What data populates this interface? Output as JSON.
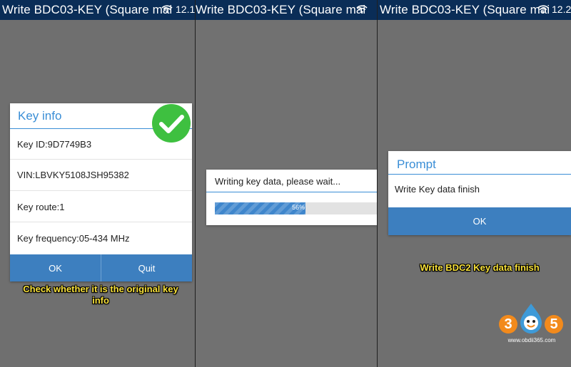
{
  "windows": {
    "left": {
      "title": "Write BDC03-KEY (Square mai",
      "clock": "12.1"
    },
    "middle": {
      "title": "Write BDC03-KEY (Square mai"
    },
    "right": {
      "title": "Write BDC03-KEY (Square mai",
      "clock": "12.2"
    }
  },
  "key_info_dialog": {
    "title": "Key info",
    "key_id": "Key ID:9D7749B3",
    "vin": "VIN:LBVKY5108JSH95382",
    "key_route": "Key route:1",
    "key_frequency": "Key frequency:05-434 MHz",
    "ok_label": "OK",
    "quit_label": "Quit"
  },
  "writing_dialog": {
    "message": "Writing key data, please wait...",
    "progress_text": "56%",
    "progress_percent": 56
  },
  "prompt_dialog": {
    "title": "Prompt",
    "message": "Write Key data finish",
    "ok_label": "OK"
  },
  "captions": {
    "left": "Check whether it is the original key info",
    "right": "Write BDC2 Key data finish"
  },
  "watermark": {
    "digits": "3 5",
    "site": "www.obdii365.com"
  },
  "colors": {
    "title_bar": "#0a2d57",
    "dialog_accent": "#3a8ed6",
    "button_bar": "#3d7fbf",
    "success_check": "#3ec040",
    "caption_text": "#f7e03a",
    "watermark_orange": "#f28a1c"
  },
  "icons": {
    "status": "wifi-icon",
    "check": "check-circle-icon",
    "logo": "obdii365-mascot-logo"
  }
}
